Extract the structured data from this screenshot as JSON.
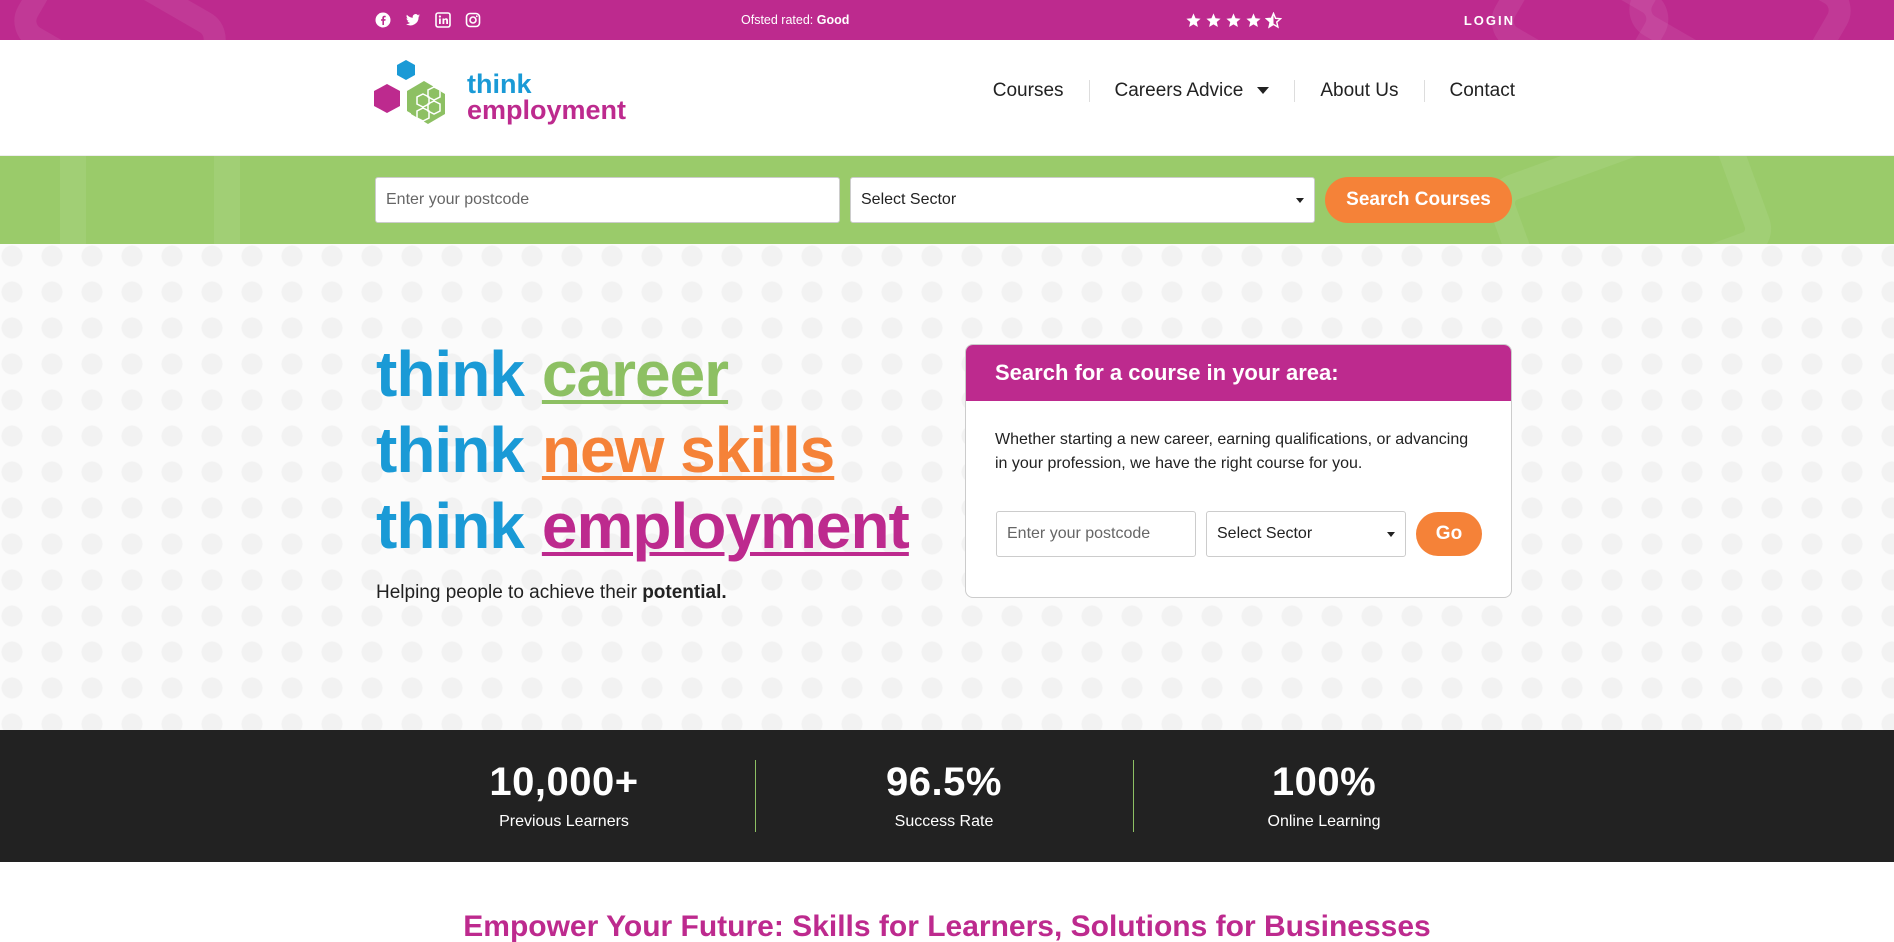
{
  "topbar": {
    "socials": [
      "facebook-icon",
      "twitter-icon",
      "linkedin-icon",
      "instagram-icon"
    ],
    "ofsted_label": "Ofsted rated:",
    "ofsted_value": "Good",
    "rating": 4.5,
    "login": "LOGIN"
  },
  "logo": {
    "line1": "think",
    "line2": "employment"
  },
  "nav": {
    "items": [
      "Courses",
      "Careers Advice",
      "About Us",
      "Contact"
    ]
  },
  "search_band": {
    "postcode_placeholder": "Enter your postcode",
    "sector_selected": "Select Sector",
    "button": "Search Courses"
  },
  "hero": {
    "line1": {
      "think": "think",
      "word": "career"
    },
    "line2": {
      "think": "think",
      "word": "new skills"
    },
    "line3": {
      "think": "think",
      "word": "employment"
    },
    "tagline": "Helping people to achieve their",
    "tagline_bold": "potential."
  },
  "card": {
    "title": "Search for a course in your area:",
    "body": "Whether starting a new career, earning qualifications, or advancing in your profession, we have the right course for you.",
    "postcode_placeholder": "Enter your postcode",
    "sector_selected": "Select Sector",
    "button": "Go"
  },
  "stats": [
    {
      "num": "10,000+",
      "label": "Previous Learners"
    },
    {
      "num": "96.5%",
      "label": "Success Rate"
    },
    {
      "num": "100%",
      "label": "Online Learning"
    }
  ],
  "section_title": "Empower Your Future: Skills for Learners, Solutions for Businesses",
  "colors": {
    "magenta": "#bd2a8e",
    "green": "#9acb6a",
    "orange": "#f58238",
    "blue": "#1a9ad6",
    "dark": "#222222"
  }
}
